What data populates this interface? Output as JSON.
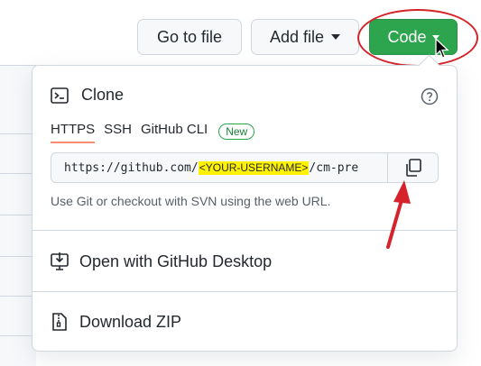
{
  "toolbar": {
    "go_to_file": "Go to file",
    "add_file": "Add file",
    "code": "Code"
  },
  "clone": {
    "title": "Clone",
    "tabs": [
      {
        "label": "HTTPS",
        "active": true
      },
      {
        "label": "SSH",
        "active": false
      },
      {
        "label": "GitHub CLI",
        "active": false
      }
    ],
    "new_badge": "New",
    "url_prefix": "https://github.com/",
    "url_placeholder": "<YOUR-USERNAME>",
    "url_suffix": "/cm-pre",
    "hint": "Use Git or checkout with SVN using the web URL."
  },
  "menu": {
    "open_desktop": "Open with GitHub Desktop",
    "download_zip": "Download ZIP"
  },
  "colors": {
    "code_button": "#2da44e",
    "highlight": "#fff200",
    "annotation": "#d6232a",
    "active_tab_underline": "#fd8c73"
  },
  "icons": {
    "terminal": "terminal-icon",
    "help": "question-circle-icon",
    "copy": "copy-icon",
    "desktop": "desktop-download-icon",
    "zip": "file-zip-icon"
  }
}
